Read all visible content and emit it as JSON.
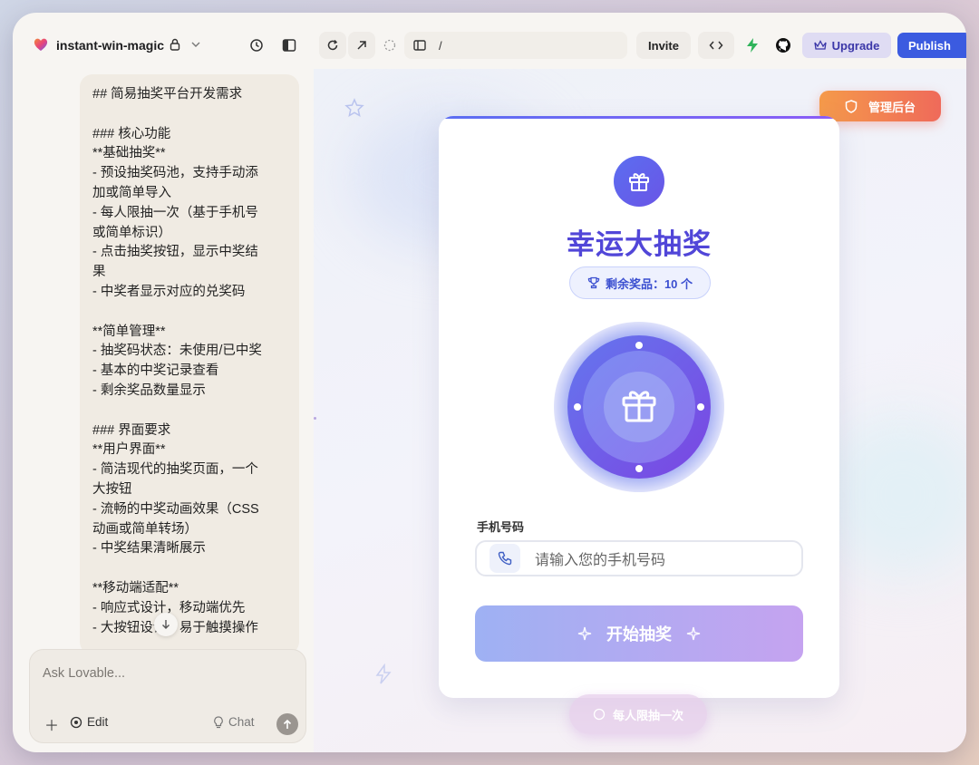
{
  "app": {
    "project_name": "instant-win-magic",
    "url_path": "/",
    "buttons": {
      "invite": "Invite",
      "upgrade": "Upgrade",
      "publish": "Publish"
    }
  },
  "chat": {
    "lines": [
      "## 简易抽奖平台开发需求",
      "",
      "### 核心功能",
      "**基础抽奖**",
      "- 预设抽奖码池，支持手动添",
      "加或简单导入",
      "- 每人限抽一次（基于手机号",
      "或简单标识）",
      "- 点击抽奖按钮，显示中奖结",
      "果",
      "- 中奖者显示对应的兑奖码",
      "",
      "**简单管理**",
      "- 抽奖码状态：未使用/已中奖",
      "- 基本的中奖记录查看",
      "- 剩余奖品数量显示",
      "",
      "### 界面要求",
      "**用户界面**",
      "- 简洁现代的抽奖页面，一个",
      "大按钮",
      "- 流畅的中奖动画效果（CSS",
      "动画或简单转场）",
      "- 中奖结果清晰展示",
      "",
      "**移动端适配**",
      "- 响应式设计，移动端优先",
      "- 大按钮设计，易于触摸操作"
    ],
    "composer": {
      "placeholder": "Ask Lovable...",
      "edit_label": "Edit",
      "chat_label": "Chat"
    }
  },
  "preview": {
    "admin_button": "管理后台",
    "title": "幸运大抽奖",
    "remaining_label": "剩余奖品：10 个",
    "phone_label": "手机号码",
    "phone_placeholder": "请输入您的手机号码",
    "start_button": "开始抽奖",
    "limit_note": "每人限抽一次"
  },
  "colors": {
    "accent_indigo": "#5146d8",
    "publish_blue": "#3b5be0",
    "admin_orange": "#ef6a5a",
    "wheel_purple": "#7c4ee8"
  },
  "icons": [
    "heart-logo-icon",
    "lock-icon",
    "chevron-down-icon",
    "history-icon",
    "sidebar-toggle-icon",
    "refresh-icon",
    "external-link-icon",
    "loading-icon",
    "layout-icon",
    "code-icon",
    "bolt-icon",
    "github-icon",
    "crown-icon",
    "shield-icon",
    "gift-icon",
    "trophy-icon",
    "phone-icon",
    "sparkle-icon",
    "plus-icon",
    "lightbulb-icon",
    "send-arrow-icon",
    "star-icon"
  ]
}
